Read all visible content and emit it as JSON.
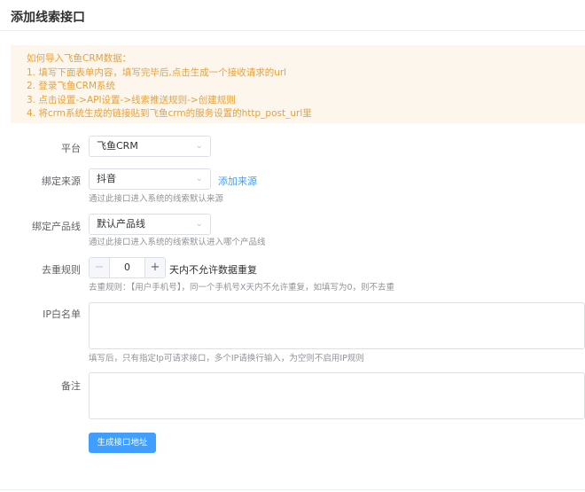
{
  "page": {
    "title": "添加线索接口"
  },
  "notice": {
    "lines": [
      "如何导入飞鱼CRM数据：",
      "1. 填写下面表单内容，填写完毕后,点击生成一个接收请求的url",
      "2. 登录飞鱼CRM系统",
      "3. 点击设置->API设置->线索推送规则->创建规则",
      "4. 将crm系统生成的链接贴到飞鱼crm的服务设置的http_post_url里"
    ]
  },
  "form": {
    "platform": {
      "label": "平台",
      "value": "飞鱼CRM"
    },
    "source": {
      "label": "绑定来源",
      "value": "抖音",
      "add_link": "添加来源",
      "hint": "通过此接口进入系统的线索默认来源"
    },
    "product": {
      "label": "绑定产品线",
      "value": "默认产品线",
      "hint": "通过此接口进入系统的线索默认进入哪个产品线"
    },
    "dedupe": {
      "label": "去重规则",
      "value": "0",
      "minus": "−",
      "plus": "+",
      "suffix": "天内不允许数据重复",
      "hint": "去重规则：【用户手机号】，同一个手机号X天内不允许重复，如填写为0，则不去重"
    },
    "ip_whitelist": {
      "label": "IP白名单",
      "value": "",
      "hint": "填写后，只有指定Ip可请求接口，多个IP请换行输入，为空则不启用IP规则"
    },
    "remark": {
      "label": "备注",
      "value": ""
    },
    "submit_label": "生成接口地址"
  },
  "colors": {
    "primary": "#409eff",
    "warning_bg": "#fdf6ec",
    "warning_text": "#e6a23c"
  },
  "icons": {
    "select_arrow": "chevron-down-icon"
  }
}
